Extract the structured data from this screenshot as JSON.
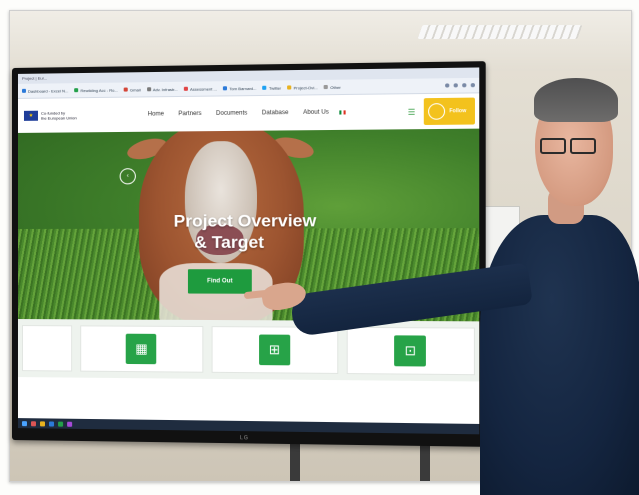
{
  "browser": {
    "tab_title": "Project | Eur...",
    "bookmarks": [
      "Dashboard - Excel N...",
      "Rewilding Acc - Ro...",
      "Gmail",
      "Adv. Infrastr...",
      "Assessment ...",
      "Tom Barnard...",
      "Twitter",
      "Project-Ovi...",
      "Other"
    ]
  },
  "site": {
    "eu_label_line1": "Co-funded by",
    "eu_label_line2": "the European Union",
    "nav": [
      "Home",
      "Partners",
      "Documents",
      "Database",
      "About Us"
    ],
    "follow_label": "Follow",
    "hero_title_line1": "Project Overview",
    "hero_title_line2": "& Target",
    "cta_label": "Find Out"
  },
  "monitor_brand": "LG",
  "colors": {
    "brand_green": "#1e9b3e",
    "follow_yellow": "#f3c21d",
    "eu_blue": "#1f3d99"
  }
}
